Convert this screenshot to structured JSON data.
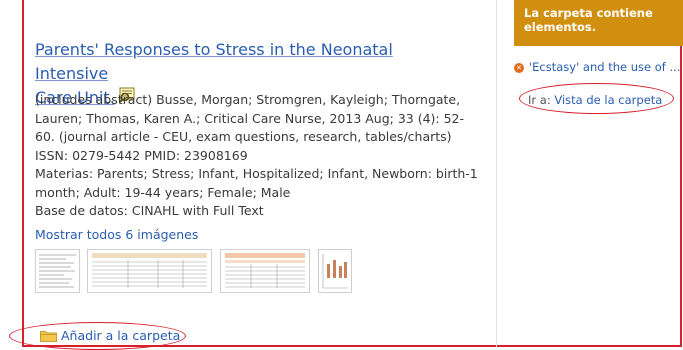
{
  "result": {
    "title_line1": "Parents' Responses to Stress in the Neonatal Intensive",
    "title_line2": "Care Unit.",
    "details": [
      "(includes abstract) Busse, Morgan; Stromgren, Kayleigh; Thorngate,",
      "Lauren; Thomas, Karen A.; Critical Care Nurse, 2013 Aug; 33 (4): 52-",
      "60. (journal article - CEU, exam questions, research, tables/charts)",
      "ISSN: 0279-5442 PMID: 23908169",
      "Materias: Parents; Stress; Infant, Hospitalized; Infant, Newborn: birth-1",
      "month; Adult: 19-44 years; Female; Male",
      "Base de datos: CINAHL with Full Text"
    ],
    "show_all_images": "Mostrar todos 6 imágenes",
    "add_to_folder": "Añadir a la carpeta"
  },
  "folder_panel": {
    "header_line1": "La carpeta contiene",
    "header_line2": "elementos.",
    "item": "'Ecstasy' and the use of ...",
    "goto_prefix": "Ir a:",
    "goto_link": "Vista de la carpeta"
  },
  "colors": {
    "link": "#2a5db0",
    "panel_header": "#d18f10",
    "highlight": "#d7202b"
  }
}
